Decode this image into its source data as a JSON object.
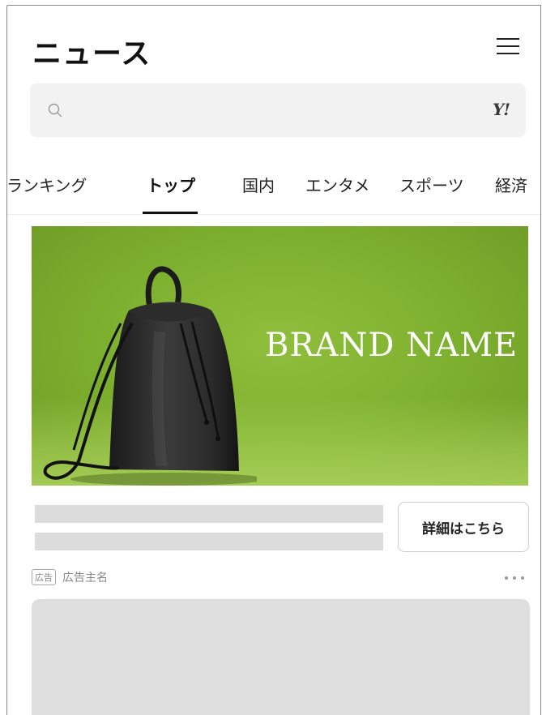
{
  "header": {
    "title": "ニュース",
    "menu_icon": "hamburger-menu-icon"
  },
  "search": {
    "placeholder": "",
    "search_icon": "search-icon",
    "logo_text": "Y!"
  },
  "tabs": [
    {
      "label": "ランキング",
      "active": false
    },
    {
      "label": "トップ",
      "active": true
    },
    {
      "label": "国内",
      "active": false
    },
    {
      "label": "エンタメ",
      "active": false
    },
    {
      "label": "スポーツ",
      "active": false
    },
    {
      "label": "経済",
      "active": false
    }
  ],
  "ad": {
    "brand_name": "BRAND NAME",
    "detail_button_label": "詳細はこちら",
    "badge_label": "広告",
    "advertiser_label": "広告主名",
    "more_icon": "more-horizontal-icon",
    "colors": {
      "banner_green": "#7fb230",
      "placeholder_gray": "#dcdcdc"
    }
  }
}
